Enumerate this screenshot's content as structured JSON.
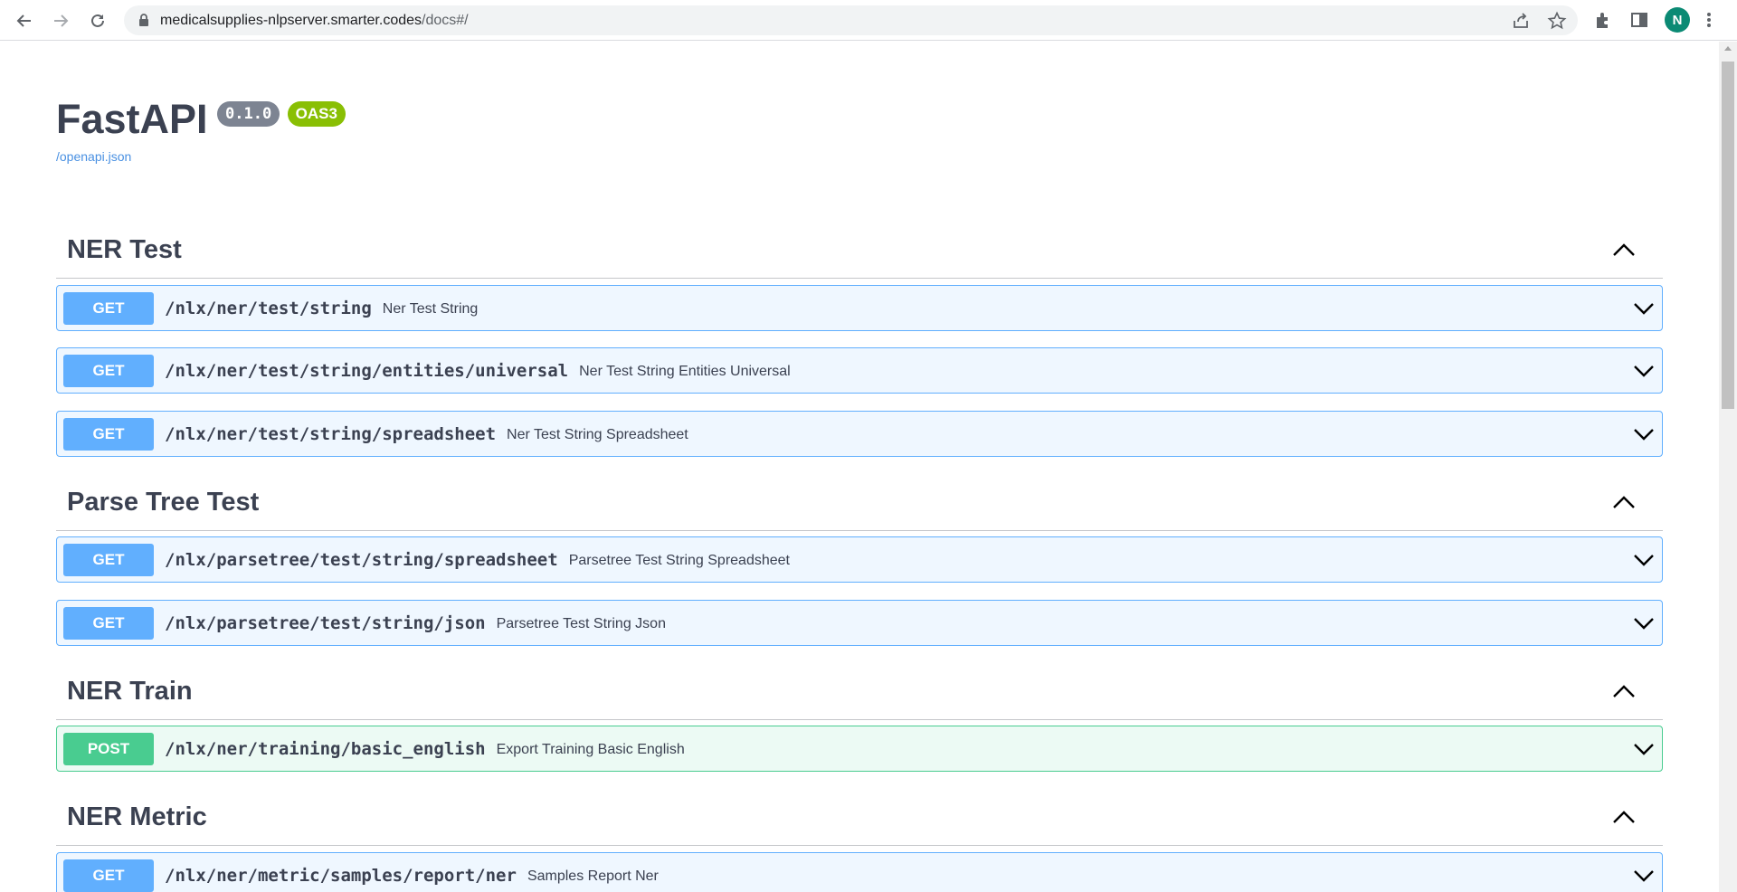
{
  "browser": {
    "url_host": "medicalsupplies-nlpserver.smarter.codes",
    "url_path": "/docs#/",
    "profile_initial": "N"
  },
  "info": {
    "title": "FastAPI",
    "version": "0.1.0",
    "oas": "OAS3",
    "spec_link": "/openapi.json"
  },
  "sections": [
    {
      "name": "NER Test",
      "operations": [
        {
          "method": "GET",
          "path": "/nlx/ner/test/string",
          "summary": "Ner Test String"
        },
        {
          "method": "GET",
          "path": "/nlx/ner/test/string/entities/universal",
          "summary": "Ner Test String Entities Universal"
        },
        {
          "method": "GET",
          "path": "/nlx/ner/test/string/spreadsheet",
          "summary": "Ner Test String Spreadsheet"
        }
      ]
    },
    {
      "name": "Parse Tree Test",
      "operations": [
        {
          "method": "GET",
          "path": "/nlx/parsetree/test/string/spreadsheet",
          "summary": "Parsetree Test String Spreadsheet"
        },
        {
          "method": "GET",
          "path": "/nlx/parsetree/test/string/json",
          "summary": "Parsetree Test String Json"
        }
      ]
    },
    {
      "name": "NER Train",
      "operations": [
        {
          "method": "POST",
          "path": "/nlx/ner/training/basic_english",
          "summary": "Export Training Basic English"
        }
      ]
    },
    {
      "name": "NER Metric",
      "operations": [
        {
          "method": "GET",
          "path": "/nlx/ner/metric/samples/report/ner",
          "summary": "Samples Report Ner"
        }
      ]
    }
  ],
  "colors": {
    "get": "#61affe",
    "post": "#49cc90",
    "version_badge": "#7d8492",
    "oas_badge": "#89bf04"
  }
}
